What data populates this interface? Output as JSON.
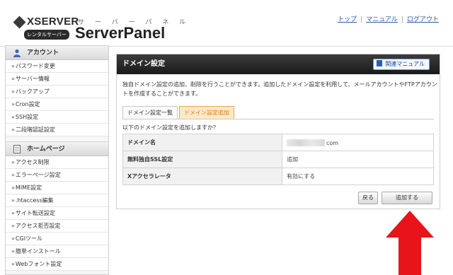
{
  "header": {
    "brand": "XSERVER",
    "rental": "レンタルサーバー",
    "sub": "サ ー バ ー パ ネ ル",
    "panel": "ServerPanel",
    "links": [
      "トップ",
      "マニュアル",
      "ログアウト"
    ]
  },
  "sidebar": {
    "account": {
      "title": "アカウント",
      "items": [
        "パスワード変更",
        "サーバー情報",
        "バックアップ",
        "Cron設定",
        "SSH設定",
        "二段階認証設定"
      ]
    },
    "homepage": {
      "title": "ホームページ",
      "items": [
        "アクセス制限",
        "エラーページ設定",
        "MIME設定",
        ".htaccess編集",
        "サイト転送設定",
        "アクセス拒否設定",
        "CGIツール",
        "簡単インストール",
        "Webフォント設定"
      ]
    }
  },
  "main": {
    "title": "ドメイン設定",
    "manual_button": "関連マニュアル",
    "description": "独自ドメイン設定の追加、削除を行うことができます。追加したドメイン設定を利用して、メールアカウントやFTPアカウントを作成することができます。",
    "tabs": [
      "ドメイン設定一覧",
      "ドメイン設定追加"
    ],
    "question": "以下のドメイン設定を追加しますか？",
    "rows": [
      {
        "label": "ドメイン名",
        "value": "com"
      },
      {
        "label": "無料独自SSL設定",
        "value": "追加"
      },
      {
        "label": "Xアクセラレータ",
        "value": "有効にする"
      }
    ],
    "back_button": "戻る",
    "add_button": "追加する"
  },
  "colors": {
    "accent_tab": "#fde9c8",
    "arrow": "#e8141a",
    "link": "#2a5aa8"
  }
}
